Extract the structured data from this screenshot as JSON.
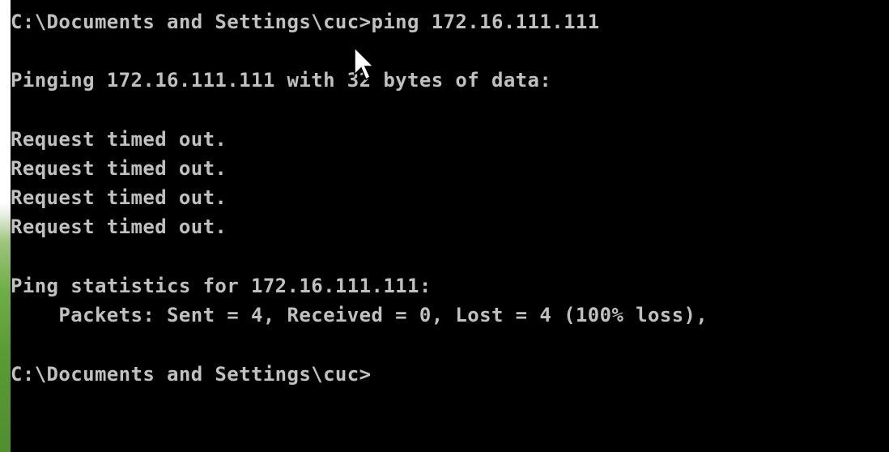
{
  "console": {
    "lines": [
      "C:\\Documents and Settings\\cuc>ping 172.16.111.111",
      "",
      "Pinging 172.16.111.111 with 32 bytes of data:",
      "",
      "Request timed out.",
      "Request timed out.",
      "Request timed out.",
      "Request timed out.",
      "",
      "Ping statistics for 172.16.111.111:",
      "    Packets: Sent = 4, Received = 0, Lost = 4 (100% loss),",
      "",
      "C:\\Documents and Settings\\cuc>"
    ],
    "text_color": "#c0c0c0",
    "background_color": "#000000"
  },
  "pointer": {
    "icon": "mouse-pointer-icon"
  }
}
